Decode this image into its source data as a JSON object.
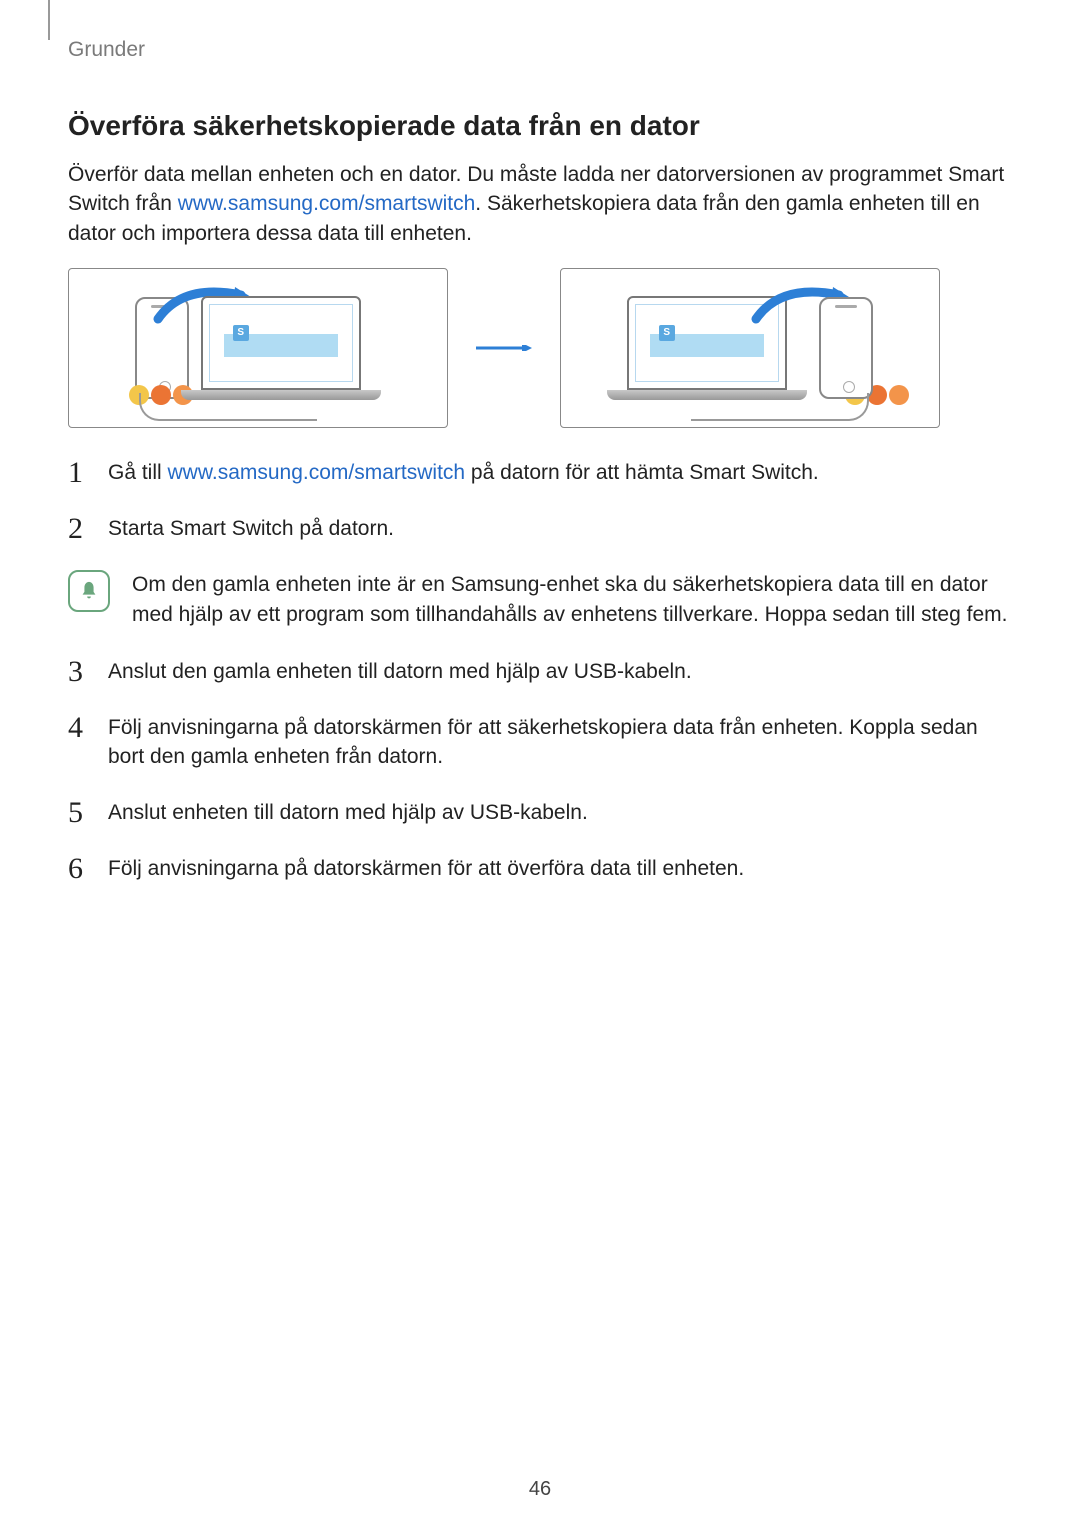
{
  "breadcrumb": "Grunder",
  "section_title": "Överföra säkerhetskopierade data från en dator",
  "intro": {
    "part1": "Överför data mellan enheten och en dator. Du måste ladda ner datorversionen av programmet Smart Switch från ",
    "link1": "www.samsung.com/smartswitch",
    "part2": ". Säkerhetskopiera data från den gamla enheten till en dator och importera dessa data till enheten."
  },
  "steps": {
    "s1": {
      "num": "1",
      "pre": "Gå till ",
      "link": "www.samsung.com/smartswitch",
      "post": " på datorn för att hämta Smart Switch."
    },
    "s2": {
      "num": "2",
      "text": "Starta Smart Switch på datorn."
    },
    "s3": {
      "num": "3",
      "text": "Anslut den gamla enheten till datorn med hjälp av USB-kabeln."
    },
    "s4": {
      "num": "4",
      "text": "Följ anvisningarna på datorskärmen för att säkerhetskopiera data från enheten. Koppla sedan bort den gamla enheten från datorn."
    },
    "s5": {
      "num": "5",
      "text": "Anslut enheten till datorn med hjälp av USB-kabeln."
    },
    "s6": {
      "num": "6",
      "text": "Följ anvisningarna på datorskärmen för att överföra data till enheten."
    }
  },
  "note": "Om den gamla enheten inte är en Samsung-enhet ska du säkerhetskopiera data till en dator med hjälp av ett program som tillhandahålls av enhetens tillverkare. Hoppa sedan till steg fem.",
  "page_number": "46"
}
